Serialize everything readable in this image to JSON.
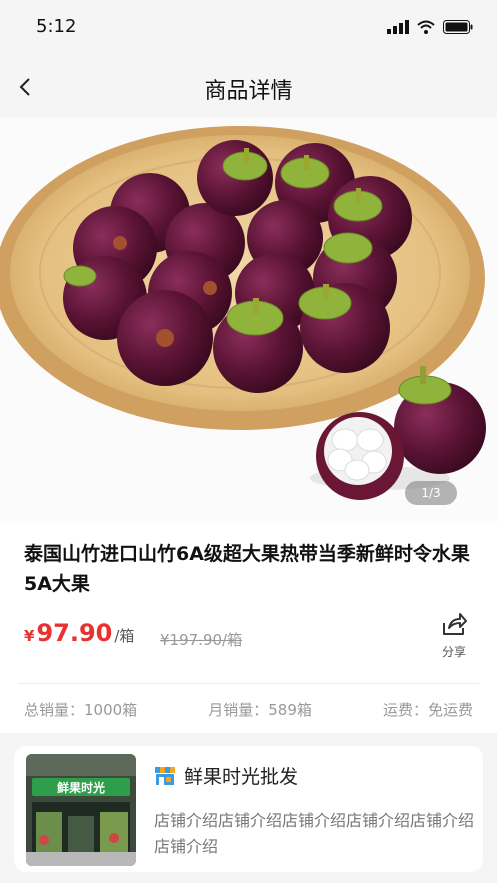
{
  "status_bar": {
    "time": "5:12"
  },
  "nav": {
    "title": "商品详情"
  },
  "hero": {
    "counter": "1/3"
  },
  "product": {
    "title": "泰国山竹进口山竹6A级超大果热带当季新鲜时令水果 5A大果",
    "currency": "¥",
    "price": "97.90",
    "unit": "/箱",
    "original_price": "¥197.90/箱",
    "share_label": "分享"
  },
  "stats": {
    "total_sales": "总销量：1000箱",
    "monthly_sales": "月销量：589箱",
    "shipping": "运费：免运费"
  },
  "shop": {
    "name": "鲜果时光批发",
    "description": "店铺介绍店铺介绍店铺介绍店铺介绍店铺介绍店铺介绍",
    "sign_text": "鲜果时光"
  },
  "colors": {
    "price": "#e8322f",
    "background": "#f5f5f5"
  }
}
